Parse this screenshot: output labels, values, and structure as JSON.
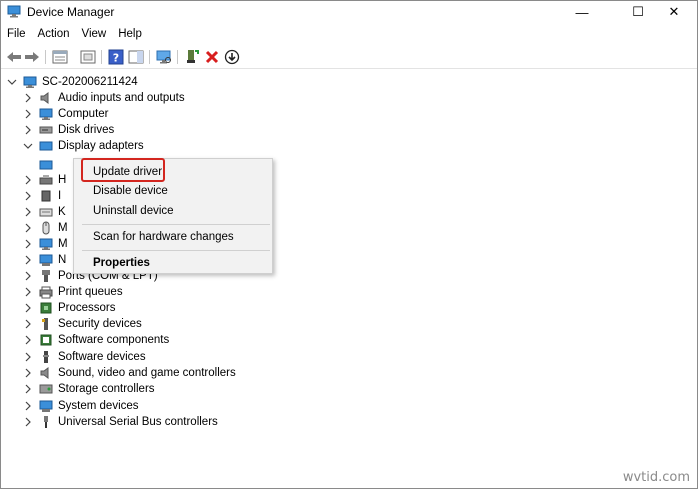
{
  "window": {
    "title": "Device Manager"
  },
  "titlebar_buttons": {
    "minimize": "—",
    "maximize": "☐",
    "close": "✕"
  },
  "menu": [
    "File",
    "Action",
    "View",
    "Help"
  ],
  "toolbar_icons": [
    "back-icon",
    "forward-icon",
    "properties-pane-icon",
    "tree-view-icon",
    "help-icon",
    "action-pane-icon",
    "scan-monitor-icon",
    "add-driver-icon",
    "uninstall-x-icon",
    "download-icon"
  ],
  "tree": {
    "root": "SC-202006211424",
    "items": [
      {
        "label": "Audio inputs and outputs",
        "icon": "speaker-icon",
        "expanded": false
      },
      {
        "label": "Computer",
        "icon": "monitor-icon",
        "expanded": false
      },
      {
        "label": "Disk drives",
        "icon": "disk-icon",
        "expanded": false
      },
      {
        "label": "Display adapters",
        "icon": "display-adapter-icon",
        "expanded": true
      },
      {
        "label": "H",
        "icon": "hid-icon",
        "expanded": false
      },
      {
        "label": "I",
        "icon": "ide-icon",
        "expanded": false
      },
      {
        "label": "K",
        "icon": "keyboard-icon",
        "expanded": false
      },
      {
        "label": "M",
        "icon": "mouse-icon",
        "expanded": false
      },
      {
        "label": "M",
        "icon": "monitor-icon",
        "expanded": false
      },
      {
        "label": "N",
        "icon": "network-icon",
        "expanded": false
      },
      {
        "label": "Ports (COM & LPT)",
        "icon": "port-icon",
        "expanded": false
      },
      {
        "label": "Print queues",
        "icon": "printer-icon",
        "expanded": false
      },
      {
        "label": "Processors",
        "icon": "processor-icon",
        "expanded": false
      },
      {
        "label": "Security devices",
        "icon": "security-key-icon",
        "expanded": false
      },
      {
        "label": "Software components",
        "icon": "software-component-icon",
        "expanded": false
      },
      {
        "label": "Software devices",
        "icon": "software-device-icon",
        "expanded": false
      },
      {
        "label": "Sound, video and game controllers",
        "icon": "sound-icon",
        "expanded": false
      },
      {
        "label": "Storage controllers",
        "icon": "storage-icon",
        "expanded": false
      },
      {
        "label": "System devices",
        "icon": "system-icon",
        "expanded": false
      },
      {
        "label": "Universal Serial Bus controllers",
        "icon": "usb-icon",
        "expanded": false
      }
    ]
  },
  "context_menu": {
    "items": [
      "Update driver",
      "Disable device",
      "Uninstall device",
      "Scan for hardware changes",
      "Properties"
    ],
    "highlighted": "Update driver"
  },
  "watermark": "wvtid.com",
  "colors": {
    "highlight_border": "#d3261f",
    "menu_bg": "#f2f2f2"
  }
}
